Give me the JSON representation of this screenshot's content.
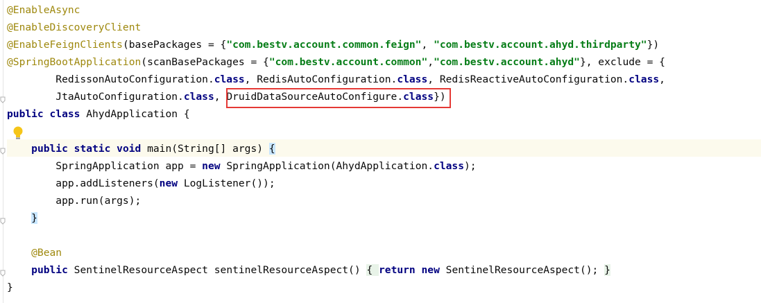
{
  "lines": [
    [
      {
        "t": "@EnableAsync",
        "c": "ann"
      }
    ],
    [
      {
        "t": "@EnableDiscoveryClient",
        "c": "ann"
      }
    ],
    [
      {
        "t": "@EnableFeignClients",
        "c": "ann"
      },
      {
        "t": "(basePackages = {",
        "c": ""
      },
      {
        "t": "\"com.bestv.account.common.feign\"",
        "c": "str"
      },
      {
        "t": ", ",
        "c": ""
      },
      {
        "t": "\"com.bestv.account.ahyd.thirdparty\"",
        "c": "str"
      },
      {
        "t": "})",
        "c": ""
      }
    ],
    [
      {
        "t": "@SpringBootApplication",
        "c": "ann"
      },
      {
        "t": "(scanBasePackages = {",
        "c": ""
      },
      {
        "t": "\"com.bestv.account.common\"",
        "c": "str"
      },
      {
        "t": ",",
        "c": ""
      },
      {
        "t": "\"com.bestv.account.ahyd\"",
        "c": "str"
      },
      {
        "t": "}, exclude = {",
        "c": ""
      }
    ],
    [
      {
        "t": "        RedissonAutoConfiguration.",
        "c": ""
      },
      {
        "t": "class",
        "c": "kw"
      },
      {
        "t": ", RedisAutoConfiguration.",
        "c": ""
      },
      {
        "t": "class",
        "c": "kw"
      },
      {
        "t": ", RedisReactiveAutoConfiguration.",
        "c": ""
      },
      {
        "t": "class",
        "c": "kw"
      },
      {
        "t": ",",
        "c": ""
      }
    ],
    [
      {
        "t": "        JtaAutoConfiguration.",
        "c": ""
      },
      {
        "t": "class",
        "c": "kw"
      },
      {
        "t": ", DruidDataSourceAutoConfigure.",
        "c": ""
      },
      {
        "t": "class",
        "c": "kw"
      },
      {
        "t": "})",
        "c": ""
      }
    ],
    [
      {
        "t": "public class ",
        "c": "kw"
      },
      {
        "t": "AhydApplication {",
        "c": ""
      }
    ],
    [
      {
        "t": "",
        "c": ""
      }
    ],
    [
      {
        "t": "    ",
        "c": ""
      },
      {
        "t": "public static void ",
        "c": "kw"
      },
      {
        "t": "main(String[] args) ",
        "c": ""
      },
      {
        "t": "{",
        "c": "hl"
      }
    ],
    [
      {
        "t": "        SpringApplication app = ",
        "c": ""
      },
      {
        "t": "new ",
        "c": "kw"
      },
      {
        "t": "SpringApplication(AhydApplication.",
        "c": ""
      },
      {
        "t": "class",
        "c": "kw"
      },
      {
        "t": ");",
        "c": ""
      }
    ],
    [
      {
        "t": "        app.addListeners(",
        "c": ""
      },
      {
        "t": "new ",
        "c": "kw"
      },
      {
        "t": "LogListener());",
        "c": ""
      }
    ],
    [
      {
        "t": "        app.run(args);",
        "c": ""
      }
    ],
    [
      {
        "t": "    ",
        "c": ""
      },
      {
        "t": "}",
        "c": "hl"
      }
    ],
    [
      {
        "t": "",
        "c": ""
      }
    ],
    [
      {
        "t": "    @Bean",
        "c": "ann"
      }
    ],
    [
      {
        "t": "    ",
        "c": ""
      },
      {
        "t": "public ",
        "c": "kw"
      },
      {
        "t": "SentinelResourceAspect sentinelResourceAspect() ",
        "c": ""
      },
      {
        "t": "{ ",
        "c": "hl2"
      },
      {
        "t": "return new ",
        "c": "kw"
      },
      {
        "t": "SentinelResourceAspect(); ",
        "c": ""
      },
      {
        "t": "}",
        "c": "hl2"
      }
    ],
    [
      {
        "t": "}",
        "c": ""
      }
    ]
  ],
  "highlight_box_text": "DruidDataSourceAutoConfigure.class"
}
